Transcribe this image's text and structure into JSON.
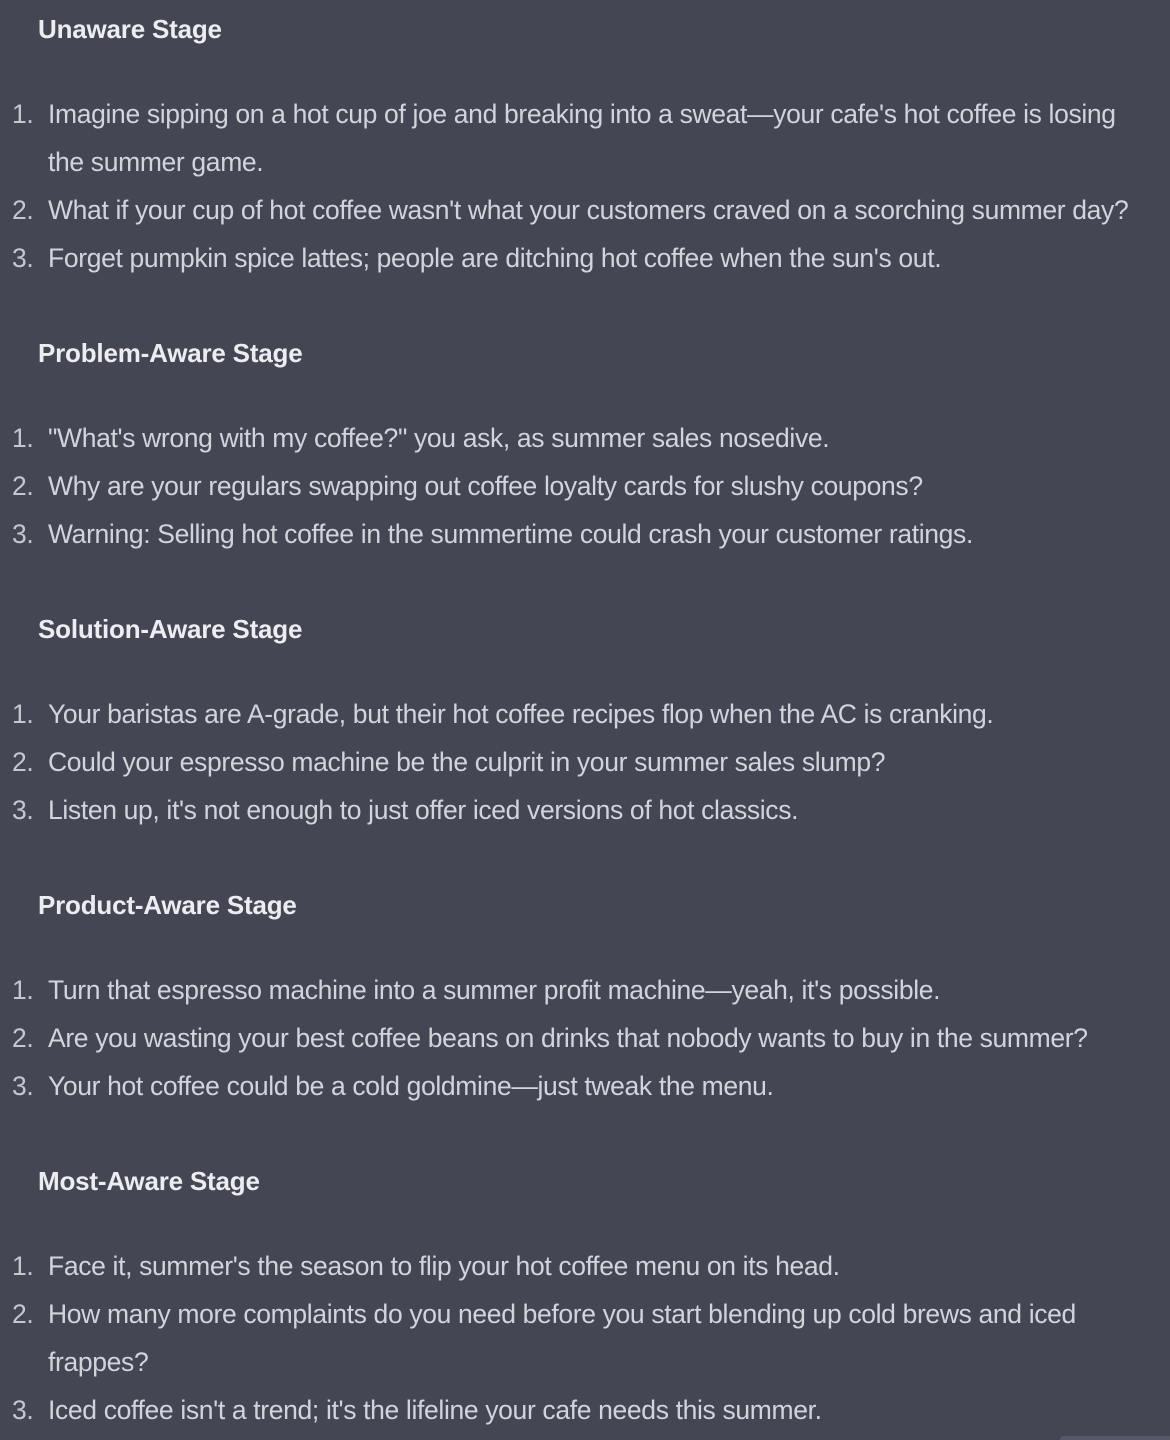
{
  "stages": [
    {
      "heading": "Unaware Stage",
      "items": [
        {
          "num": "1.",
          "text": "Imagine sipping on a hot cup of joe and breaking into a sweat—your cafe's hot coffee is losing the summer game."
        },
        {
          "num": "2.",
          "text": "What if your cup of hot coffee wasn't what your customers craved on a scorching summer day?"
        },
        {
          "num": "3.",
          "text": "Forget pumpkin spice lattes; people are ditching hot coffee when the sun's out."
        }
      ]
    },
    {
      "heading": "Problem-Aware Stage",
      "items": [
        {
          "num": "1.",
          "text": "\"What's wrong with my coffee?\" you ask, as summer sales nosedive."
        },
        {
          "num": "2.",
          "text": "Why are your regulars swapping out coffee loyalty cards for slushy coupons?"
        },
        {
          "num": "3.",
          "text": "Warning: Selling hot coffee in the summertime could crash your customer ratings."
        }
      ]
    },
    {
      "heading": "Solution-Aware Stage",
      "items": [
        {
          "num": "1.",
          "text": "Your baristas are A-grade, but their hot coffee recipes flop when the AC is cranking."
        },
        {
          "num": "2.",
          "text": "Could your espresso machine be the culprit in your summer sales slump?"
        },
        {
          "num": "3.",
          "text": "Listen up, it's not enough to just offer iced versions of hot classics."
        }
      ]
    },
    {
      "heading": "Product-Aware Stage",
      "items": [
        {
          "num": "1.",
          "text": "Turn that espresso machine into a summer profit machine—yeah, it's possible."
        },
        {
          "num": "2.",
          "text": "Are you wasting your best coffee beans on drinks that nobody wants to buy in the summer?"
        },
        {
          "num": "3.",
          "text": "Your hot coffee could be a cold goldmine—just tweak the menu."
        }
      ]
    },
    {
      "heading": "Most-Aware Stage",
      "items": [
        {
          "num": "1.",
          "text": "Face it, summer's the season to flip your hot coffee menu on its head."
        },
        {
          "num": "2.",
          "text": "How many more complaints do you need before you start blending up cold brews and iced frappes?"
        },
        {
          "num": "3.",
          "text": "Iced coffee isn't a trend; it's the lifeline your cafe needs this summer."
        }
      ]
    }
  ],
  "colors": {
    "background": "#444654",
    "heading": "#ececf1",
    "body_text": "#d1d5db"
  }
}
